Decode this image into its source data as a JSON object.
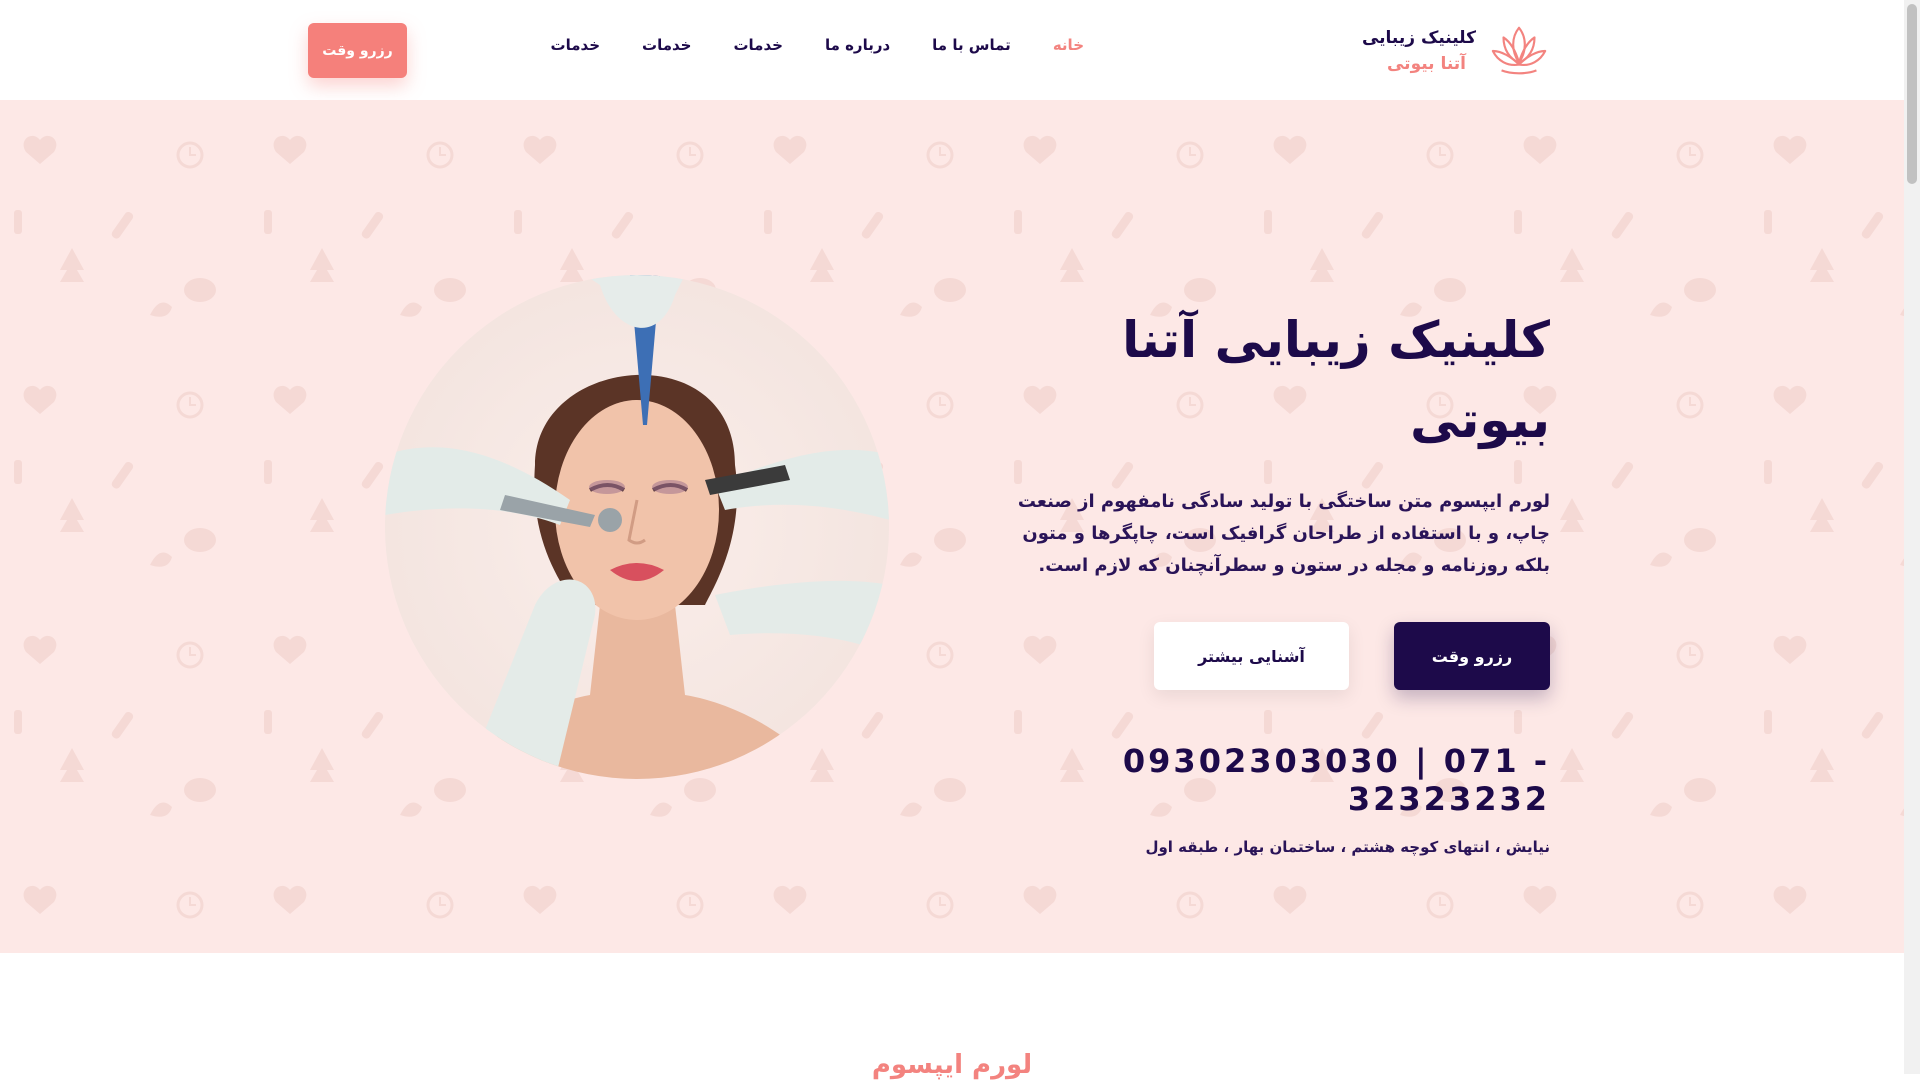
{
  "header": {
    "logo": {
      "line1": "کلینیک زیبایی",
      "line2": "آتنا بیوتی"
    },
    "nav": [
      {
        "label": "خانه",
        "active": true
      },
      {
        "label": "تماس با ما",
        "active": false
      },
      {
        "label": "درباره ما",
        "active": false
      },
      {
        "label": "خدمات",
        "active": false
      },
      {
        "label": "خدمات",
        "active": false
      },
      {
        "label": "خدمات",
        "active": false
      }
    ],
    "cta_label": "رزرو وقت"
  },
  "hero": {
    "title": "کلینیک زیبایی آتنا بیوتی",
    "description": "لورم ایپسوم متن ساختگی با تولید سادگی نامفهوم از صنعت چاپ، و با استفاده از طراحان گرافیک است، چاپگرها و متون بلکه روزنامه و مجله در ستون و سطرآنچنان که لازم است.",
    "primary_button": "رزرو وقت",
    "secondary_button": "آشنایی بیشتر",
    "phone": "09302303030 | 071 - 32323232",
    "address": "نیایش ، انتهای کوچه هشتم ، ساختمان بهار ، طبقه اول"
  },
  "section": {
    "title": "لورم ایپسوم"
  },
  "colors": {
    "navy": "#1d0a4a",
    "coral": "#f5807b",
    "hero_bg": "#fde8e6"
  },
  "icons": {
    "logo": "lotus-icon"
  }
}
